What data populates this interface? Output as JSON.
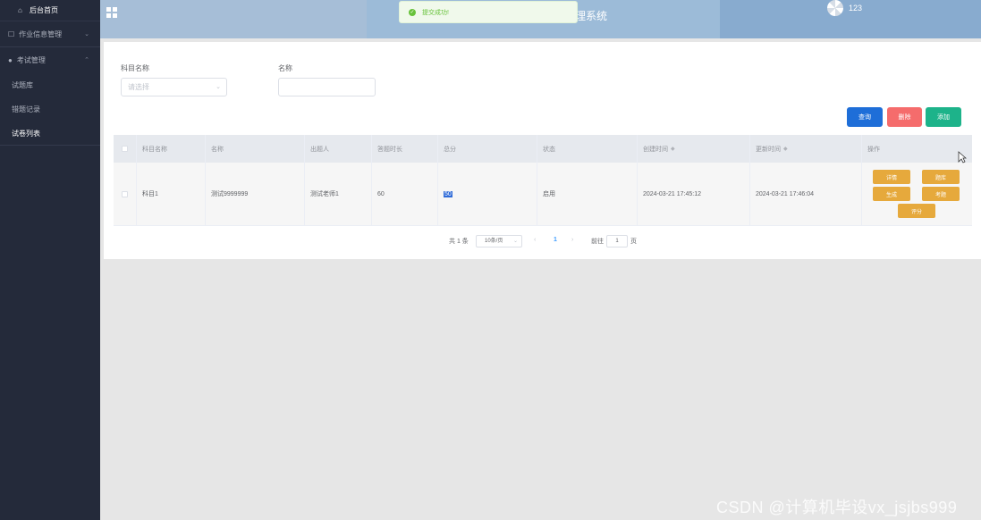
{
  "sidebar": {
    "home": "后台首页",
    "groups": [
      {
        "label": "作业信息管理"
      },
      {
        "label": "考试管理",
        "items": [
          "试题库",
          "错题记录",
          "试卷列表"
        ]
      }
    ]
  },
  "header": {
    "title_partial": "理系统",
    "username": "123"
  },
  "toast": {
    "message": "提交成功!"
  },
  "filters": {
    "subject_label": "科目名称",
    "subject_placeholder": "请选择",
    "name_label": "名称",
    "name_value": ""
  },
  "toolbar": {
    "query": "查询",
    "delete": "删除",
    "add": "添加"
  },
  "table": {
    "headers": [
      "科目名称",
      "名称",
      "出题人",
      "答题时长",
      "总分",
      "状态",
      "创建时间",
      "更新时间",
      "操作"
    ],
    "rows": [
      {
        "subject": "科目1",
        "name": "测试9999999",
        "author": "测试老师1",
        "duration": "60",
        "total": "50",
        "status": "启用",
        "created": "2024-03-21 17:45:12",
        "updated": "2024-03-21 17:46:04",
        "actions": [
          "详情",
          "题库",
          "生成",
          "考题",
          "评分"
        ]
      }
    ]
  },
  "pagination": {
    "total": "共 1 条",
    "page_size": "10条/页",
    "current": "1",
    "goto_prefix": "前往",
    "goto_value": "1",
    "goto_suffix": "页"
  },
  "watermark": "CSDN @计算机毕设vx_jsjbs999",
  "colors": {
    "sidebar_bg": "#242a3a",
    "header_bg": "#a6bed7",
    "query_btn": "#1e6ed8",
    "delete_btn": "#f56c6c",
    "add_btn": "#1db38a",
    "action_btn": "#e6a93c",
    "success": "#67c23a"
  }
}
